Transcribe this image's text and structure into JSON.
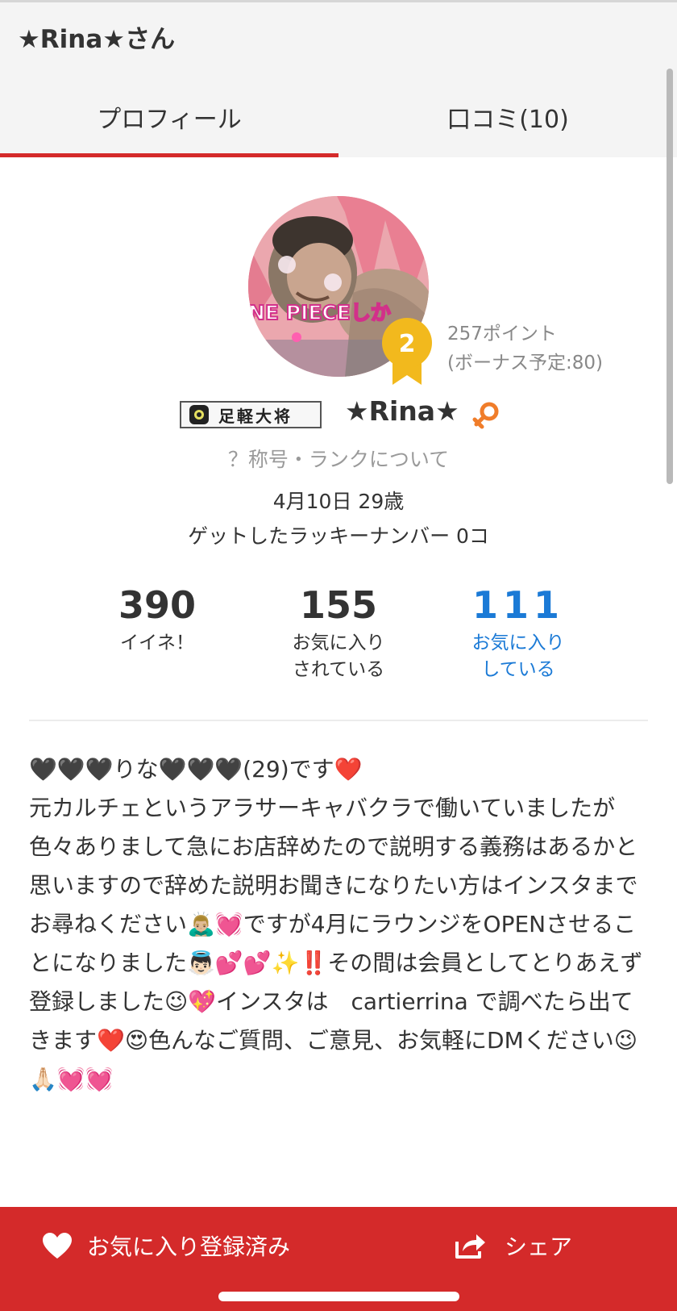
{
  "header": {
    "title": "★Rina★さん",
    "tabs": [
      {
        "label": "プロフィール",
        "active": true
      },
      {
        "label": "口コミ(10)",
        "active": false
      }
    ]
  },
  "profile": {
    "rank": "2",
    "points": "257ポイント",
    "bonus": "(ボーナス予定:80)",
    "title_badge": "足軽大将",
    "username": "★Rina★",
    "gender": "female",
    "rank_info_link": "？称号・ランクについて",
    "birthday": "4月10日 29歳",
    "lucky_number": "ゲットしたラッキーナンバー  0コ",
    "avatar_text": "NE PIECEしか"
  },
  "stats": [
    {
      "value": "390",
      "label_line1": "イイネ！",
      "label_line2": ""
    },
    {
      "value": "155",
      "label_line1": "お気に入り",
      "label_line2": "されている"
    },
    {
      "value": "111",
      "label_line1": "お気に入り",
      "label_line2": "している"
    }
  ],
  "bio": "🖤🖤🖤りな🖤🖤🖤(29)です❤️\n元カルチェというアラサーキャバクラで働いていましたが色々ありまして急にお店辞めたので説明する義務はあるかと思いますので辞めた説明お聞きになりたい方はインスタまでお尋ねください🙇🏼‍♂️💓ですが4月にラウンジをOPENさせることになりました👼🏻💕💕✨‼️その間は会員としてとりあえず登録しました😉💖インスタは　cartierrina で調べたら出てきます❤️😍色んなご質問、ご意見、お気軽にDMください😉🙏🏻💓💓",
  "bottom_bar": {
    "favorite_label": "お気に入り登録済み",
    "share_label": "シェア"
  },
  "colors": {
    "accent_red": "#d42a2a",
    "link_blue": "#1b7ad6",
    "badge_gold": "#f2b91d",
    "gender_orange": "#f07d2a"
  },
  "icons": {
    "favorite": "heart-icon",
    "share": "share-icon",
    "gender": "female-icon",
    "rank": "medal-icon"
  }
}
